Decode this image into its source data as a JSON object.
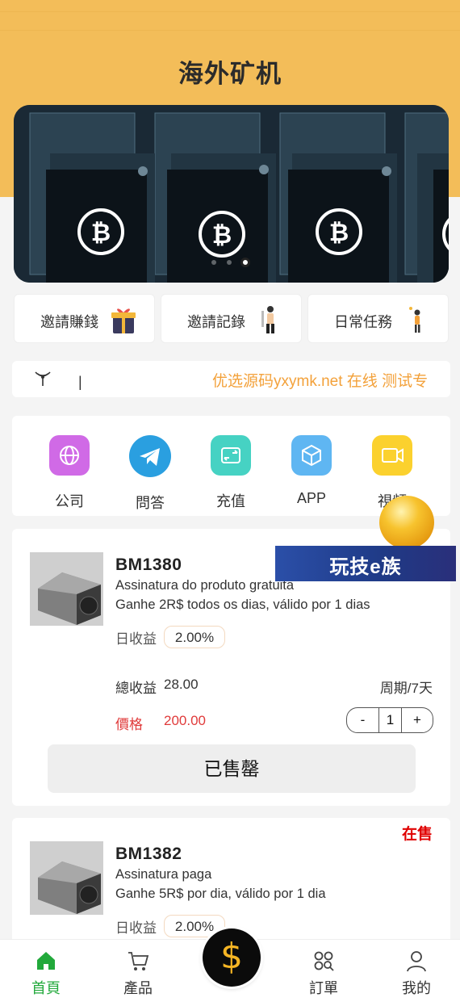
{
  "header": {
    "title": "海外矿机"
  },
  "banner": {
    "slide_count": 3,
    "active_slide": 3
  },
  "quick_links": [
    {
      "label": "邀請賺錢",
      "icon": "gift-icon"
    },
    {
      "label": "邀請記錄",
      "icon": "person-record-icon"
    },
    {
      "label": "日常任務",
      "icon": "person-task-icon"
    }
  ],
  "notice": {
    "icon": "broadcast-icon",
    "bar": "|",
    "text": "优选源码yxymk.net 在线 测试专"
  },
  "menu": [
    {
      "label": "公司",
      "icon": "globe-icon",
      "color": "#d06ae6"
    },
    {
      "label": "問答",
      "icon": "telegram-icon",
      "color": "#2a9fe0"
    },
    {
      "label": "充值",
      "icon": "wallet-icon",
      "color": "#46d2c3"
    },
    {
      "label": "APP",
      "icon": "box-icon",
      "color": "#5fb6f2"
    },
    {
      "label": "視頻",
      "icon": "video-icon",
      "color": "#fbd12e"
    }
  ],
  "floating_ad": {
    "text": "玩技e族"
  },
  "products": [
    {
      "name": "BM1380",
      "desc1": "Assinatura do produto gratuita",
      "desc2": "Ganhe 2R$ todos os dias, válido por 1 dias",
      "daily_label": "日收益",
      "daily_rate": "2.00%",
      "total_label": "總收益",
      "total_value": "28.00",
      "period": "周期/7天",
      "price_label": "價格",
      "price_value": "200.00",
      "qty_minus": "-",
      "qty": "1",
      "qty_plus": "+",
      "button": "已售罄",
      "status": ""
    },
    {
      "name": "BM1382",
      "desc1": "Assinatura paga",
      "desc2": "Ganhe 5R$ por dia, válido por 1 dia",
      "daily_label": "日收益",
      "daily_rate": "2.00%",
      "status": "在售"
    }
  ],
  "tabbar": [
    {
      "label": "首頁",
      "icon": "home-icon",
      "active": true
    },
    {
      "label": "產品",
      "icon": "cart-icon",
      "active": false
    },
    {
      "label": "$",
      "icon": "dollar-icon",
      "active": false
    },
    {
      "label": "訂單",
      "icon": "orders-icon",
      "active": false
    },
    {
      "label": "我的",
      "icon": "user-icon",
      "active": false
    }
  ],
  "colors": {
    "header_bg": "#f3bd59",
    "accent_green": "#22a93b",
    "price_red": "#e03a3a",
    "status_red": "#e00000",
    "marquee_orange": "#f3a13a"
  }
}
